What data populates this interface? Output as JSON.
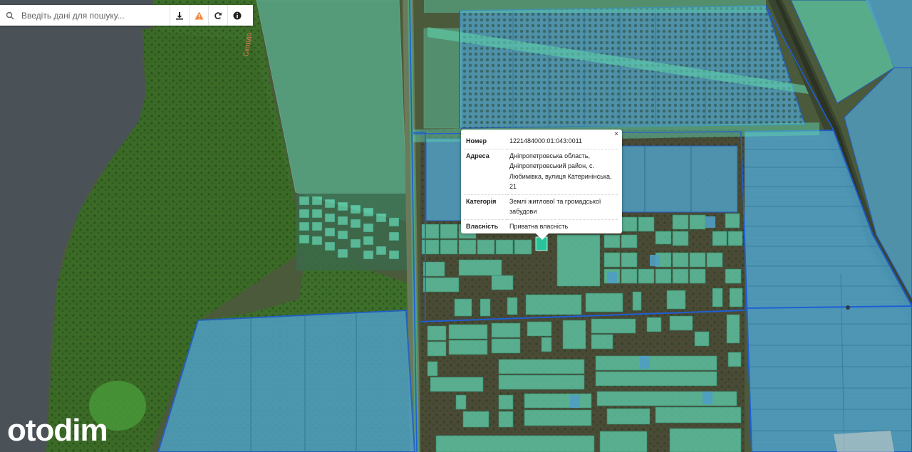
{
  "search": {
    "placeholder": "Введіть дані для пошуку..."
  },
  "toolbar": {
    "icons": [
      "search-icon",
      "download-icon",
      "warning-icon",
      "refresh-icon",
      "info-icon"
    ],
    "warning_color": "#f0863a"
  },
  "popup": {
    "close_label": "×",
    "rows": [
      {
        "key": "Номер",
        "value": "1221484000:01:043:0011"
      },
      {
        "key": "Адреса",
        "value": "Дніпропетровська область, Дніпропетровський район, с. Любимівка, вулиця Катеринінська, 21"
      },
      {
        "key": "Категорія",
        "value": "Землі житлової та громадської забудови"
      },
      {
        "key": "Власність",
        "value": "Приватна власність"
      }
    ]
  },
  "map": {
    "road_label": "Скордо",
    "colors": {
      "water": "#4a5258",
      "forest": "#3d6e2a",
      "parcel_blue": "#4f9fc4",
      "parcel_green": "#5fd0ad",
      "parcel_outline": "#1f5fd6",
      "selected_parcel": "#29c49a"
    }
  },
  "watermark": "otodim"
}
